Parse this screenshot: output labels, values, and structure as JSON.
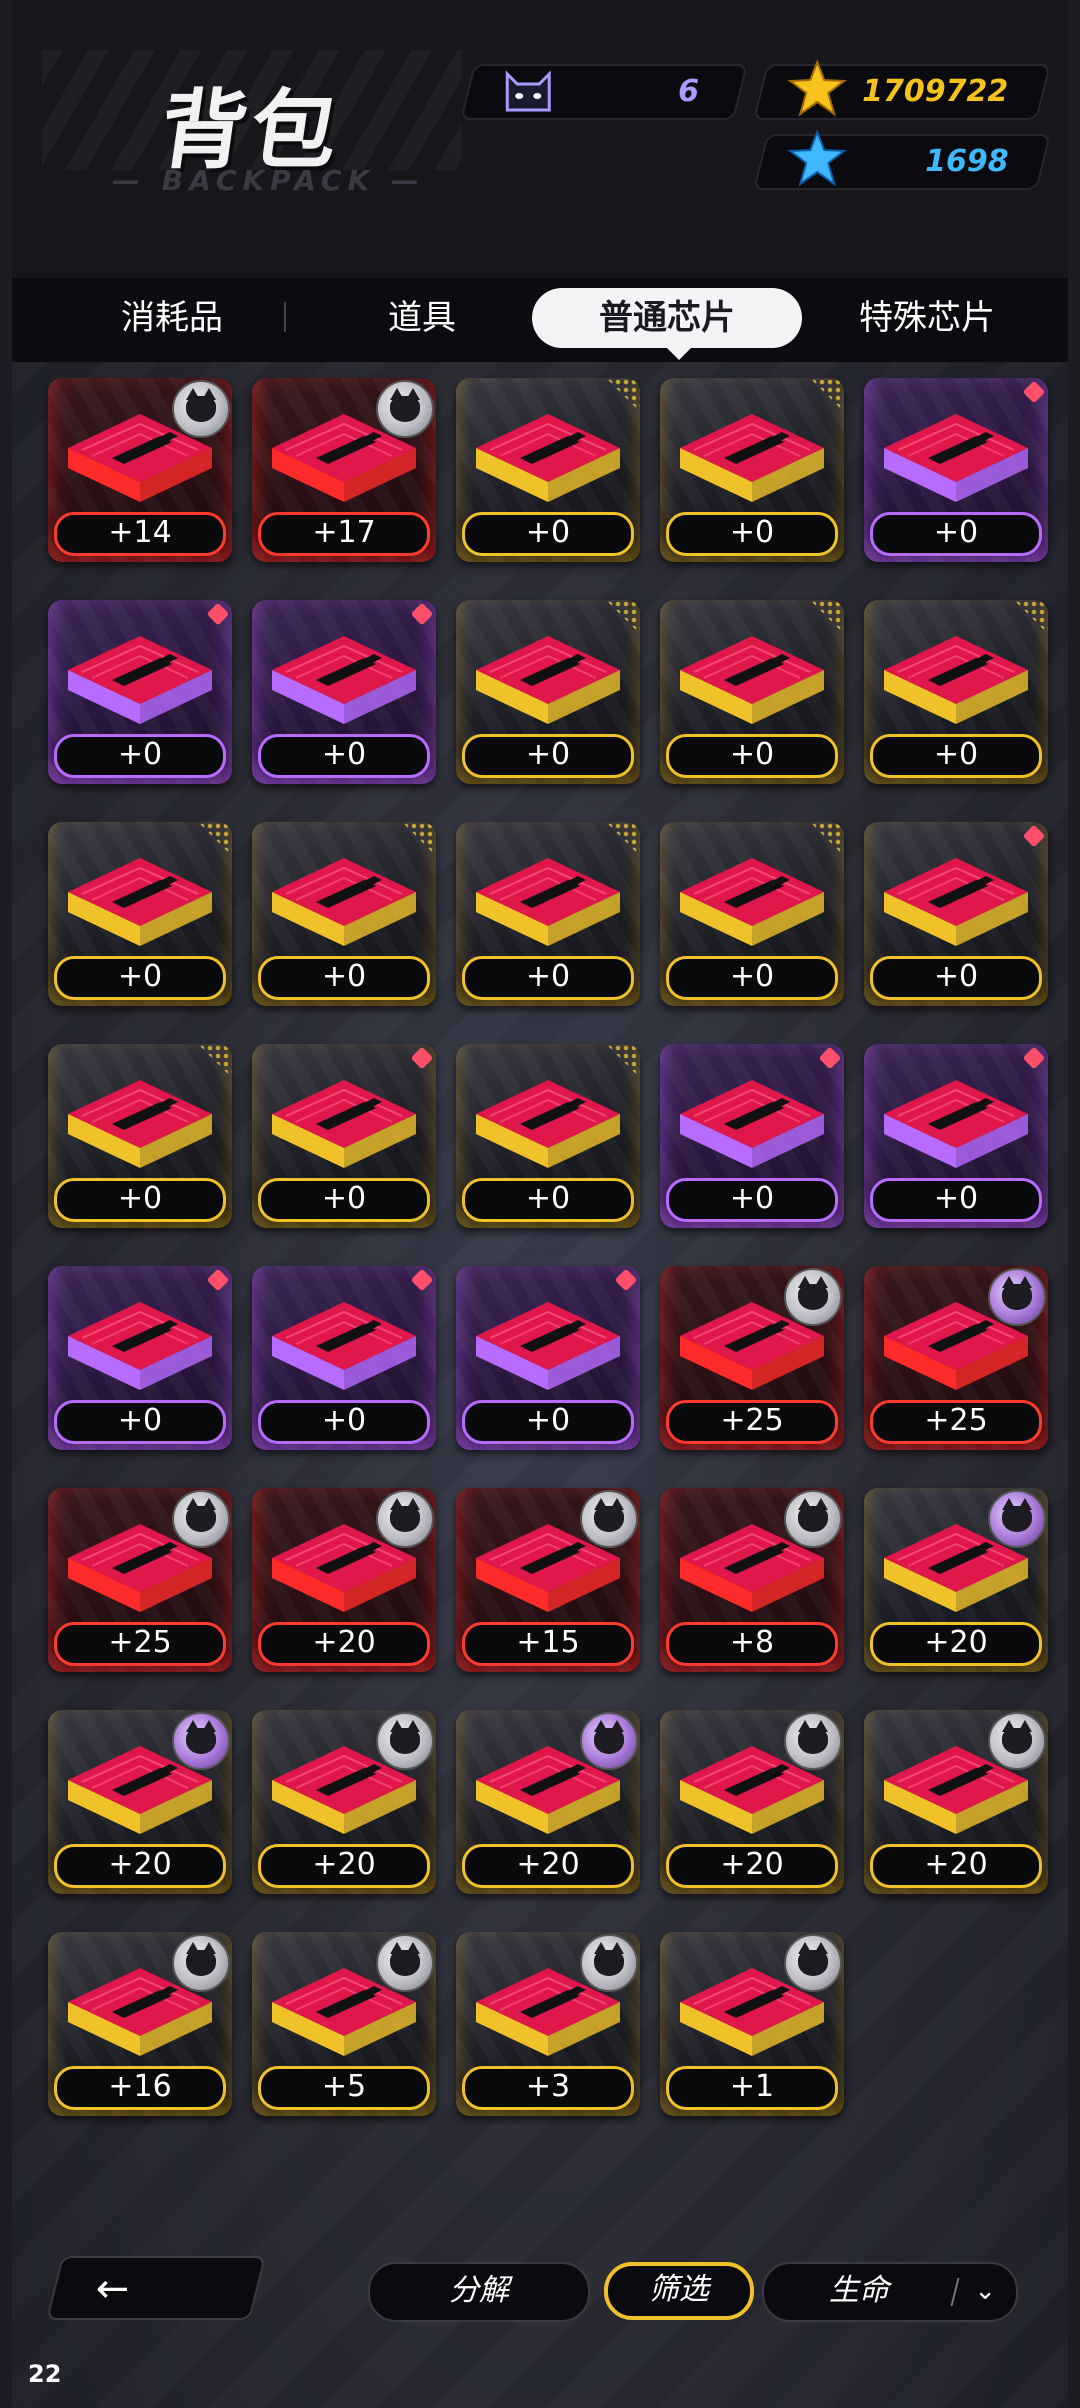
{
  "header": {
    "title": "背包",
    "subtitle": "— BACKPACK —",
    "resources": {
      "cat_count": "6",
      "gold": "1709722",
      "gems": "1698"
    }
  },
  "tabs": [
    {
      "label": "消耗品",
      "active": false
    },
    {
      "label": "道具",
      "active": false
    },
    {
      "label": "普通芯片",
      "active": true
    },
    {
      "label": "特殊芯片",
      "active": false
    }
  ],
  "items": [
    {
      "level": "+14",
      "rarity": "red",
      "corner": "avatar"
    },
    {
      "level": "+17",
      "rarity": "red",
      "corner": "avatar"
    },
    {
      "level": "+0",
      "rarity": "gold",
      "corner": "dots"
    },
    {
      "level": "+0",
      "rarity": "gold",
      "corner": "dots"
    },
    {
      "level": "+0",
      "rarity": "purple",
      "corner": "dot"
    },
    {
      "level": "+0",
      "rarity": "purple",
      "corner": "dot"
    },
    {
      "level": "+0",
      "rarity": "purple",
      "corner": "dot"
    },
    {
      "level": "+0",
      "rarity": "gold",
      "corner": "dots"
    },
    {
      "level": "+0",
      "rarity": "gold",
      "corner": "dots"
    },
    {
      "level": "+0",
      "rarity": "gold",
      "corner": "dots"
    },
    {
      "level": "+0",
      "rarity": "gold",
      "corner": "dots"
    },
    {
      "level": "+0",
      "rarity": "gold",
      "corner": "dots"
    },
    {
      "level": "+0",
      "rarity": "gold",
      "corner": "dots"
    },
    {
      "level": "+0",
      "rarity": "gold",
      "corner": "dots"
    },
    {
      "level": "+0",
      "rarity": "gold",
      "corner": "dot"
    },
    {
      "level": "+0",
      "rarity": "gold",
      "corner": "dots"
    },
    {
      "level": "+0",
      "rarity": "gold",
      "corner": "dot"
    },
    {
      "level": "+0",
      "rarity": "gold",
      "corner": "dots"
    },
    {
      "level": "+0",
      "rarity": "purple",
      "corner": "dot"
    },
    {
      "level": "+0",
      "rarity": "purple",
      "corner": "dot"
    },
    {
      "level": "+0",
      "rarity": "purple",
      "corner": "dot"
    },
    {
      "level": "+0",
      "rarity": "purple",
      "corner": "dot"
    },
    {
      "level": "+0",
      "rarity": "purple",
      "corner": "dot"
    },
    {
      "level": "+25",
      "rarity": "red",
      "corner": "avatar"
    },
    {
      "level": "+25",
      "rarity": "red",
      "corner": "avatar-purple"
    },
    {
      "level": "+25",
      "rarity": "red",
      "corner": "avatar"
    },
    {
      "level": "+20",
      "rarity": "red",
      "corner": "avatar"
    },
    {
      "level": "+15",
      "rarity": "red",
      "corner": "avatar"
    },
    {
      "level": "+8",
      "rarity": "red",
      "corner": "avatar"
    },
    {
      "level": "+20",
      "rarity": "gold",
      "corner": "avatar-purple"
    },
    {
      "level": "+20",
      "rarity": "gold",
      "corner": "avatar-purple"
    },
    {
      "level": "+20",
      "rarity": "gold",
      "corner": "avatar"
    },
    {
      "level": "+20",
      "rarity": "gold",
      "corner": "avatar-purple"
    },
    {
      "level": "+20",
      "rarity": "gold",
      "corner": "avatar"
    },
    {
      "level": "+20",
      "rarity": "gold",
      "corner": "avatar"
    },
    {
      "level": "+16",
      "rarity": "gold",
      "corner": "avatar"
    },
    {
      "level": "+5",
      "rarity": "gold",
      "corner": "avatar"
    },
    {
      "level": "+3",
      "rarity": "gold",
      "corner": "avatar"
    },
    {
      "level": "+1",
      "rarity": "gold",
      "corner": "avatar"
    }
  ],
  "bottom_bar": {
    "back_icon": "arrow-left-icon",
    "decompose_label": "分解",
    "filter_label": "筛选",
    "sort_label": "生命",
    "sort_chevron": "chevron-down-icon"
  },
  "page_number": "22",
  "colors": {
    "gold": "#f0c22a",
    "purple": "#b86bff",
    "red": "#ff3b30",
    "chip_pink": "#e0174a"
  }
}
